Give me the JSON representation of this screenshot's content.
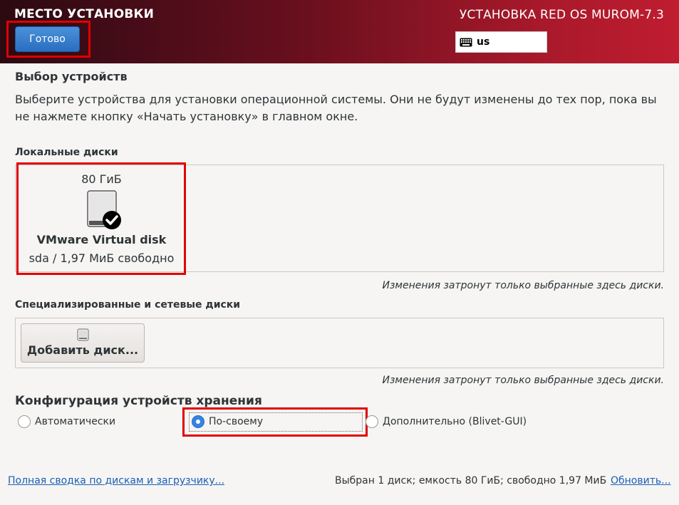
{
  "header": {
    "title": "МЕСТО УСТАНОВКИ",
    "product": "УСТАНОВКА RED OS MUROM-7.3",
    "done_label": "Готово",
    "keyboard_layout": "us",
    "gradient_colors": [
      "#2b0a12",
      "#c01d30"
    ]
  },
  "device_selection": {
    "heading": "Выбор устройств",
    "description": "Выберите устройства для установки операционной системы. Они не будут изменены до тех пор, пока вы не нажмете кнопку «Начать установку» в главном окне."
  },
  "local_disks": {
    "heading": "Локальные диски",
    "disks": [
      {
        "size": "80 ГиБ",
        "name": "VMware Virtual disk",
        "free": "sda / 1,97 МиБ свободно",
        "icon": "hard-disk-icon",
        "selected": true
      }
    ],
    "note": "Изменения затронут только выбранные здесь диски."
  },
  "special_disks": {
    "heading": "Специализированные и сетевые диски",
    "add_label": "Добавить диск...",
    "note": "Изменения затронут только выбранные здесь диски."
  },
  "storage_config": {
    "heading": "Конфигурация устройств хранения",
    "options": [
      {
        "label": "Автоматически",
        "selected": false
      },
      {
        "label": "По-своему",
        "selected": true
      },
      {
        "label": "Дополнительно (Blivet-GUI)",
        "selected": false
      }
    ]
  },
  "footer": {
    "summary_link": "Полная сводка по дискам и загрузчику...",
    "status": "Выбран 1 диск; емкость 80 ГиБ; свободно 1,97 МиБ",
    "refresh_link": "Обновить..."
  },
  "colors": {
    "accent": "#3584e4",
    "highlight": "#e00000",
    "link": "#1a5fb4"
  }
}
